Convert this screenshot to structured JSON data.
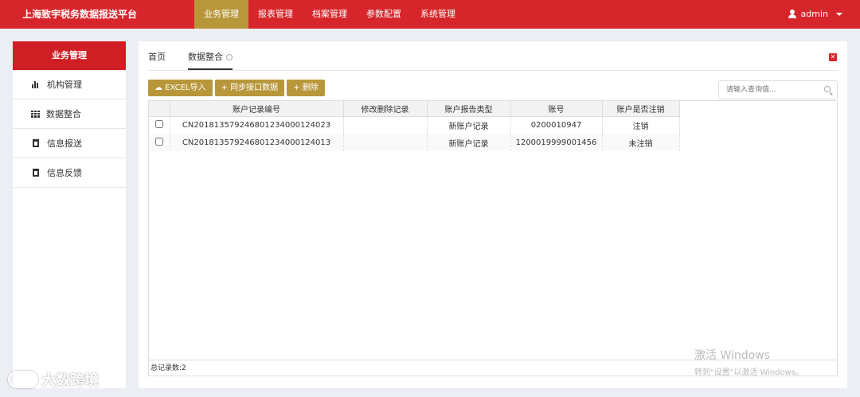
{
  "app": {
    "title": "上海致宇税务数据报送平台"
  },
  "nav": [
    {
      "label": "业务管理",
      "active": true
    },
    {
      "label": "报表管理"
    },
    {
      "label": "档案管理"
    },
    {
      "label": "参数配置"
    },
    {
      "label": "系统管理"
    }
  ],
  "user": {
    "name": "admin"
  },
  "sidebar": {
    "title": "业务管理",
    "items": [
      {
        "label": "机构管理",
        "icon": "bar-chart-icon"
      },
      {
        "label": "数据整合",
        "icon": "grid-icon"
      },
      {
        "label": "信息报送",
        "icon": "document-icon"
      },
      {
        "label": "信息反馈",
        "icon": "document-icon"
      }
    ]
  },
  "tabs": [
    {
      "label": "首页"
    },
    {
      "label": "数据整合",
      "active": true
    }
  ],
  "toolbar": {
    "excel_import": "EXCEL导入",
    "sync": "+ 同步接口数据",
    "delete": "+ 删除"
  },
  "search": {
    "placeholder": "请输入查询值..."
  },
  "table": {
    "columns": [
      "账户记录编号",
      "修改删除记录",
      "账户报告类型",
      "账号",
      "账户是否注销"
    ],
    "rows": [
      {
        "id": "CN20181357924680123400012​4023",
        "modify": "",
        "type": "新账户记录",
        "account": "0200010947",
        "closed": "注销"
      },
      {
        "id": "CN20181357924680123400012​4013",
        "modify": "",
        "type": "新账户记录",
        "account": "1200019999001456",
        "closed": "未注销"
      }
    ],
    "footer": "总记录数:2"
  },
  "overlay": {
    "activate_title": "激活 Windows",
    "activate_sub": "转到\"设置\"以激活 Windows。",
    "watermark": "大数跨境"
  },
  "colors": {
    "primary": "#d7262b",
    "accent": "#b8973b"
  }
}
